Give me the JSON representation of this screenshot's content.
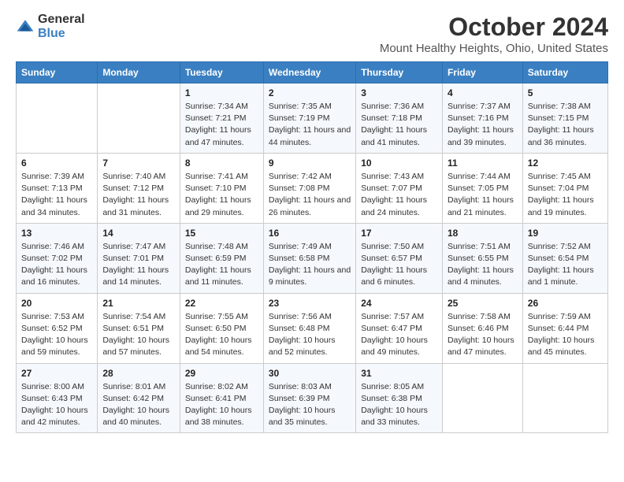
{
  "logo": {
    "line1": "General",
    "line2": "Blue"
  },
  "title": "October 2024",
  "subtitle": "Mount Healthy Heights, Ohio, United States",
  "days_header": [
    "Sunday",
    "Monday",
    "Tuesday",
    "Wednesday",
    "Thursday",
    "Friday",
    "Saturday"
  ],
  "weeks": [
    [
      {
        "day": "",
        "sunrise": "",
        "sunset": "",
        "daylight": ""
      },
      {
        "day": "",
        "sunrise": "",
        "sunset": "",
        "daylight": ""
      },
      {
        "day": "1",
        "sunrise": "Sunrise: 7:34 AM",
        "sunset": "Sunset: 7:21 PM",
        "daylight": "Daylight: 11 hours and 47 minutes."
      },
      {
        "day": "2",
        "sunrise": "Sunrise: 7:35 AM",
        "sunset": "Sunset: 7:19 PM",
        "daylight": "Daylight: 11 hours and 44 minutes."
      },
      {
        "day": "3",
        "sunrise": "Sunrise: 7:36 AM",
        "sunset": "Sunset: 7:18 PM",
        "daylight": "Daylight: 11 hours and 41 minutes."
      },
      {
        "day": "4",
        "sunrise": "Sunrise: 7:37 AM",
        "sunset": "Sunset: 7:16 PM",
        "daylight": "Daylight: 11 hours and 39 minutes."
      },
      {
        "day": "5",
        "sunrise": "Sunrise: 7:38 AM",
        "sunset": "Sunset: 7:15 PM",
        "daylight": "Daylight: 11 hours and 36 minutes."
      }
    ],
    [
      {
        "day": "6",
        "sunrise": "Sunrise: 7:39 AM",
        "sunset": "Sunset: 7:13 PM",
        "daylight": "Daylight: 11 hours and 34 minutes."
      },
      {
        "day": "7",
        "sunrise": "Sunrise: 7:40 AM",
        "sunset": "Sunset: 7:12 PM",
        "daylight": "Daylight: 11 hours and 31 minutes."
      },
      {
        "day": "8",
        "sunrise": "Sunrise: 7:41 AM",
        "sunset": "Sunset: 7:10 PM",
        "daylight": "Daylight: 11 hours and 29 minutes."
      },
      {
        "day": "9",
        "sunrise": "Sunrise: 7:42 AM",
        "sunset": "Sunset: 7:08 PM",
        "daylight": "Daylight: 11 hours and 26 minutes."
      },
      {
        "day": "10",
        "sunrise": "Sunrise: 7:43 AM",
        "sunset": "Sunset: 7:07 PM",
        "daylight": "Daylight: 11 hours and 24 minutes."
      },
      {
        "day": "11",
        "sunrise": "Sunrise: 7:44 AM",
        "sunset": "Sunset: 7:05 PM",
        "daylight": "Daylight: 11 hours and 21 minutes."
      },
      {
        "day": "12",
        "sunrise": "Sunrise: 7:45 AM",
        "sunset": "Sunset: 7:04 PM",
        "daylight": "Daylight: 11 hours and 19 minutes."
      }
    ],
    [
      {
        "day": "13",
        "sunrise": "Sunrise: 7:46 AM",
        "sunset": "Sunset: 7:02 PM",
        "daylight": "Daylight: 11 hours and 16 minutes."
      },
      {
        "day": "14",
        "sunrise": "Sunrise: 7:47 AM",
        "sunset": "Sunset: 7:01 PM",
        "daylight": "Daylight: 11 hours and 14 minutes."
      },
      {
        "day": "15",
        "sunrise": "Sunrise: 7:48 AM",
        "sunset": "Sunset: 6:59 PM",
        "daylight": "Daylight: 11 hours and 11 minutes."
      },
      {
        "day": "16",
        "sunrise": "Sunrise: 7:49 AM",
        "sunset": "Sunset: 6:58 PM",
        "daylight": "Daylight: 11 hours and 9 minutes."
      },
      {
        "day": "17",
        "sunrise": "Sunrise: 7:50 AM",
        "sunset": "Sunset: 6:57 PM",
        "daylight": "Daylight: 11 hours and 6 minutes."
      },
      {
        "day": "18",
        "sunrise": "Sunrise: 7:51 AM",
        "sunset": "Sunset: 6:55 PM",
        "daylight": "Daylight: 11 hours and 4 minutes."
      },
      {
        "day": "19",
        "sunrise": "Sunrise: 7:52 AM",
        "sunset": "Sunset: 6:54 PM",
        "daylight": "Daylight: 11 hours and 1 minute."
      }
    ],
    [
      {
        "day": "20",
        "sunrise": "Sunrise: 7:53 AM",
        "sunset": "Sunset: 6:52 PM",
        "daylight": "Daylight: 10 hours and 59 minutes."
      },
      {
        "day": "21",
        "sunrise": "Sunrise: 7:54 AM",
        "sunset": "Sunset: 6:51 PM",
        "daylight": "Daylight: 10 hours and 57 minutes."
      },
      {
        "day": "22",
        "sunrise": "Sunrise: 7:55 AM",
        "sunset": "Sunset: 6:50 PM",
        "daylight": "Daylight: 10 hours and 54 minutes."
      },
      {
        "day": "23",
        "sunrise": "Sunrise: 7:56 AM",
        "sunset": "Sunset: 6:48 PM",
        "daylight": "Daylight: 10 hours and 52 minutes."
      },
      {
        "day": "24",
        "sunrise": "Sunrise: 7:57 AM",
        "sunset": "Sunset: 6:47 PM",
        "daylight": "Daylight: 10 hours and 49 minutes."
      },
      {
        "day": "25",
        "sunrise": "Sunrise: 7:58 AM",
        "sunset": "Sunset: 6:46 PM",
        "daylight": "Daylight: 10 hours and 47 minutes."
      },
      {
        "day": "26",
        "sunrise": "Sunrise: 7:59 AM",
        "sunset": "Sunset: 6:44 PM",
        "daylight": "Daylight: 10 hours and 45 minutes."
      }
    ],
    [
      {
        "day": "27",
        "sunrise": "Sunrise: 8:00 AM",
        "sunset": "Sunset: 6:43 PM",
        "daylight": "Daylight: 10 hours and 42 minutes."
      },
      {
        "day": "28",
        "sunrise": "Sunrise: 8:01 AM",
        "sunset": "Sunset: 6:42 PM",
        "daylight": "Daylight: 10 hours and 40 minutes."
      },
      {
        "day": "29",
        "sunrise": "Sunrise: 8:02 AM",
        "sunset": "Sunset: 6:41 PM",
        "daylight": "Daylight: 10 hours and 38 minutes."
      },
      {
        "day": "30",
        "sunrise": "Sunrise: 8:03 AM",
        "sunset": "Sunset: 6:39 PM",
        "daylight": "Daylight: 10 hours and 35 minutes."
      },
      {
        "day": "31",
        "sunrise": "Sunrise: 8:05 AM",
        "sunset": "Sunset: 6:38 PM",
        "daylight": "Daylight: 10 hours and 33 minutes."
      },
      {
        "day": "",
        "sunrise": "",
        "sunset": "",
        "daylight": ""
      },
      {
        "day": "",
        "sunrise": "",
        "sunset": "",
        "daylight": ""
      }
    ]
  ]
}
